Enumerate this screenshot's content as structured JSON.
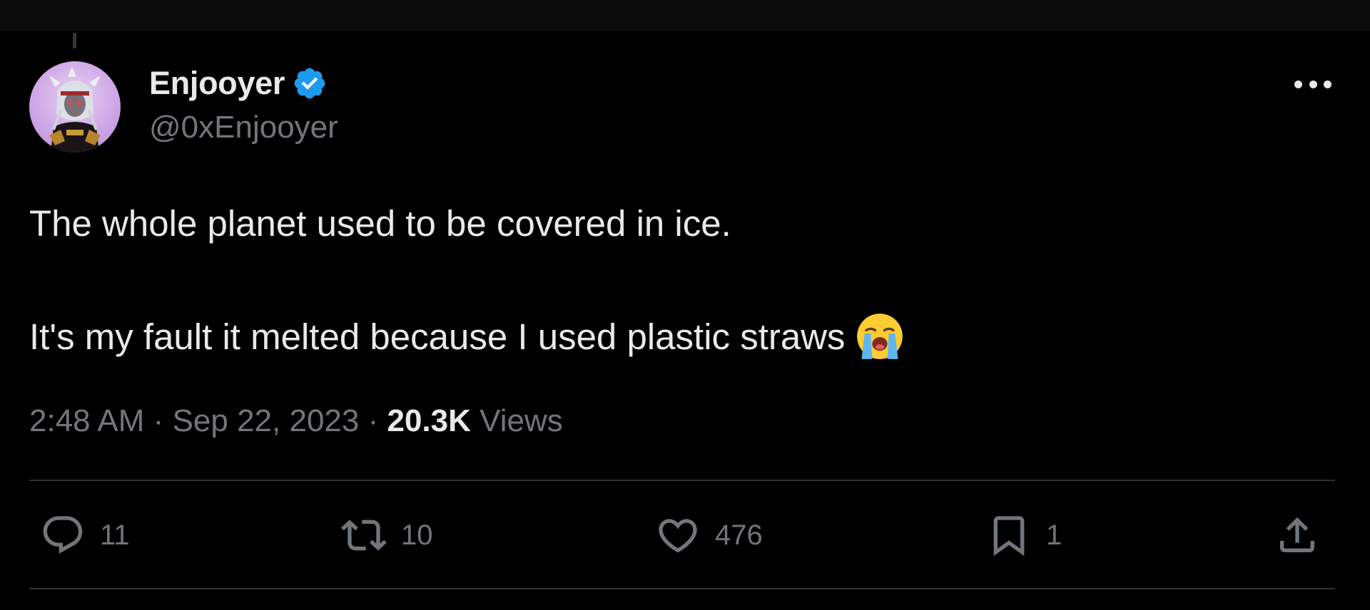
{
  "tweet": {
    "author": {
      "display_name": "Enjooyer",
      "handle": "@0xEnjooyer",
      "verified": true,
      "avatar_icon": "avatar-image"
    },
    "text": {
      "line1": "The whole planet used to be covered in ice.",
      "line2": "It's my fault it melted because I used plastic straws",
      "emoji": "loudly-crying-face"
    },
    "meta": {
      "time": "2:48 AM",
      "separator": "·",
      "date": "Sep 22, 2023",
      "views_count": "20.3K",
      "views_label": "Views"
    },
    "actions": {
      "replies": "11",
      "retweets": "10",
      "likes": "476",
      "bookmarks": "1"
    }
  },
  "colors": {
    "background": "#000000",
    "primary_text": "#e7e9ea",
    "secondary_text": "#71767b",
    "divider": "#2f3336",
    "verified_badge": "#1d9bf0"
  }
}
